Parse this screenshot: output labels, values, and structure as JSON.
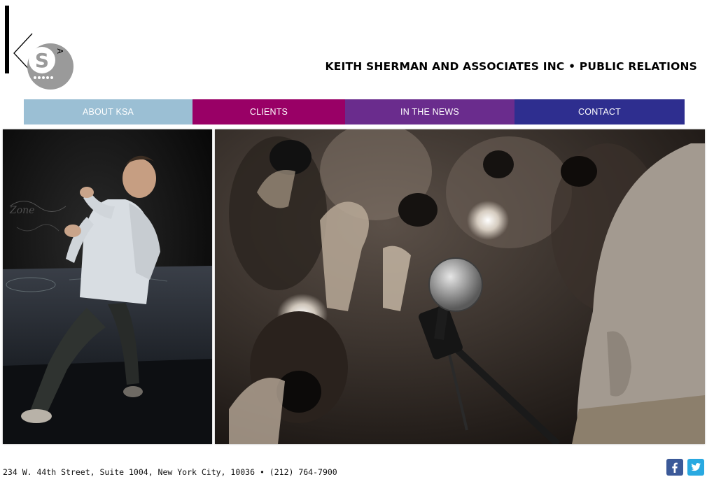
{
  "header": {
    "tagline": "KEITH SHERMAN AND ASSOCIATES INC • PUBLIC RELATIONS",
    "logo_letters": [
      "K",
      "S",
      "A"
    ]
  },
  "nav": {
    "items": [
      {
        "label": "ABOUT KSA",
        "color": "#9bbfd4"
      },
      {
        "label": "CLIENTS",
        "color": "#990066"
      },
      {
        "label": "IN THE NEWS",
        "color": "#6a2c8d"
      },
      {
        "label": "CONTACT",
        "color": "#2e2e8f"
      }
    ]
  },
  "footer": {
    "address": "234 W. 44th Street, Suite 1004, New York City, 10036 • (212) 764-7900",
    "social": [
      "facebook-icon",
      "twitter-icon"
    ]
  }
}
